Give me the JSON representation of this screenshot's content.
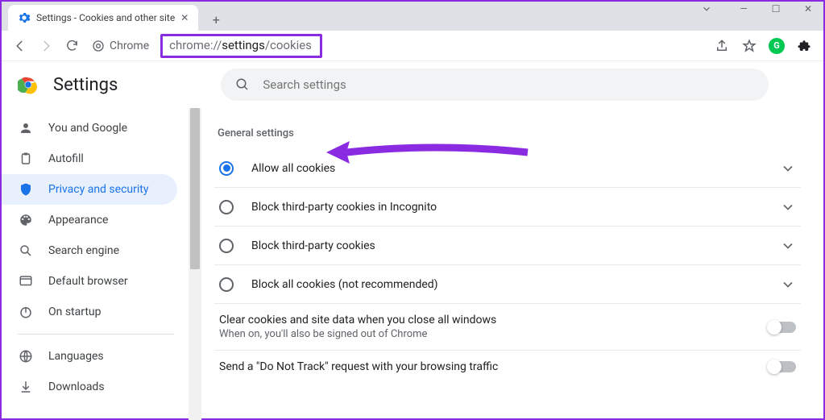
{
  "tab": {
    "title": "Settings - Cookies and other site"
  },
  "address": {
    "prefix": "Chrome",
    "url_plain1": "chrome://",
    "url_dark": "settings",
    "url_plain2": "/cookies"
  },
  "header": {
    "title": "Settings",
    "search_placeholder": "Search settings"
  },
  "sidebar": {
    "items": [
      {
        "label": "You and Google"
      },
      {
        "label": "Autofill"
      },
      {
        "label": "Privacy and security"
      },
      {
        "label": "Appearance"
      },
      {
        "label": "Search engine"
      },
      {
        "label": "Default browser"
      },
      {
        "label": "On startup"
      }
    ],
    "items2": [
      {
        "label": "Languages"
      },
      {
        "label": "Downloads"
      }
    ]
  },
  "content": {
    "section_title": "General settings",
    "radios": [
      {
        "label": "Allow all cookies"
      },
      {
        "label": "Block third-party cookies in Incognito"
      },
      {
        "label": "Block third-party cookies"
      },
      {
        "label": "Block all cookies (not recommended)"
      }
    ],
    "toggles": [
      {
        "main": "Clear cookies and site data when you close all windows",
        "sub": "When on, you'll also be signed out of Chrome"
      },
      {
        "main": "Send a \"Do Not Track\" request with your browsing traffic",
        "sub": ""
      }
    ]
  }
}
